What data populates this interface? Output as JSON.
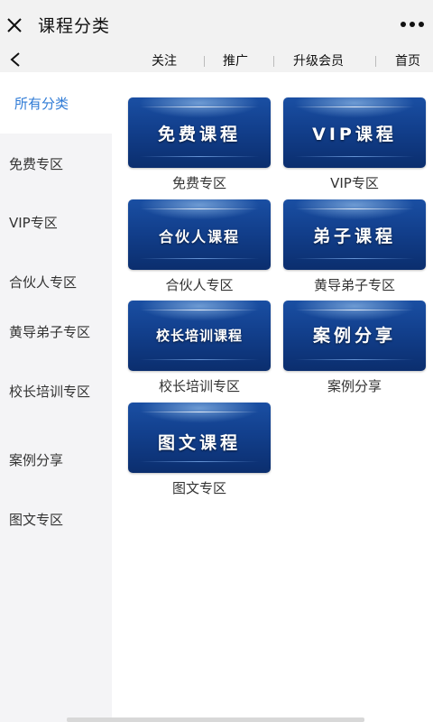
{
  "header": {
    "title": "课程分类"
  },
  "subnav": {
    "links": [
      "关注",
      "推广",
      "升级会员",
      "首页"
    ]
  },
  "sidebar": {
    "items": [
      {
        "label": "所有分类"
      },
      {
        "label": "免费专区"
      },
      {
        "label": "VIP专区"
      },
      {
        "label": "合伙人专区"
      },
      {
        "label": "黄导弟子专区"
      },
      {
        "label": "校长培训专区"
      },
      {
        "label": "案例分享"
      },
      {
        "label": "图文专区"
      }
    ],
    "active_index": 0,
    "active_color": "#2f7bd6"
  },
  "categories": [
    {
      "banner": "免费课程",
      "label": "免费专区"
    },
    {
      "banner": "VIP课程",
      "label": "VIP专区"
    },
    {
      "banner": "合伙人课程",
      "label": "合伙人专区"
    },
    {
      "banner": "弟子课程",
      "label": "黄导弟子专区"
    },
    {
      "banner": "校长培训课程",
      "label": "校长培训专区"
    },
    {
      "banner": "案例分享",
      "label": "案例分享"
    },
    {
      "banner": "图文课程",
      "label": "图文专区"
    }
  ],
  "colors": {
    "banner_top": "#1a4fa3",
    "banner_bottom": "#0b2e6e",
    "sidebar_bg": "#f4f4f6",
    "header_bg": "#f2f2f2"
  },
  "icons": {
    "close": "close-icon",
    "more": "more-dots-icon",
    "back": "back-arrow-icon"
  }
}
